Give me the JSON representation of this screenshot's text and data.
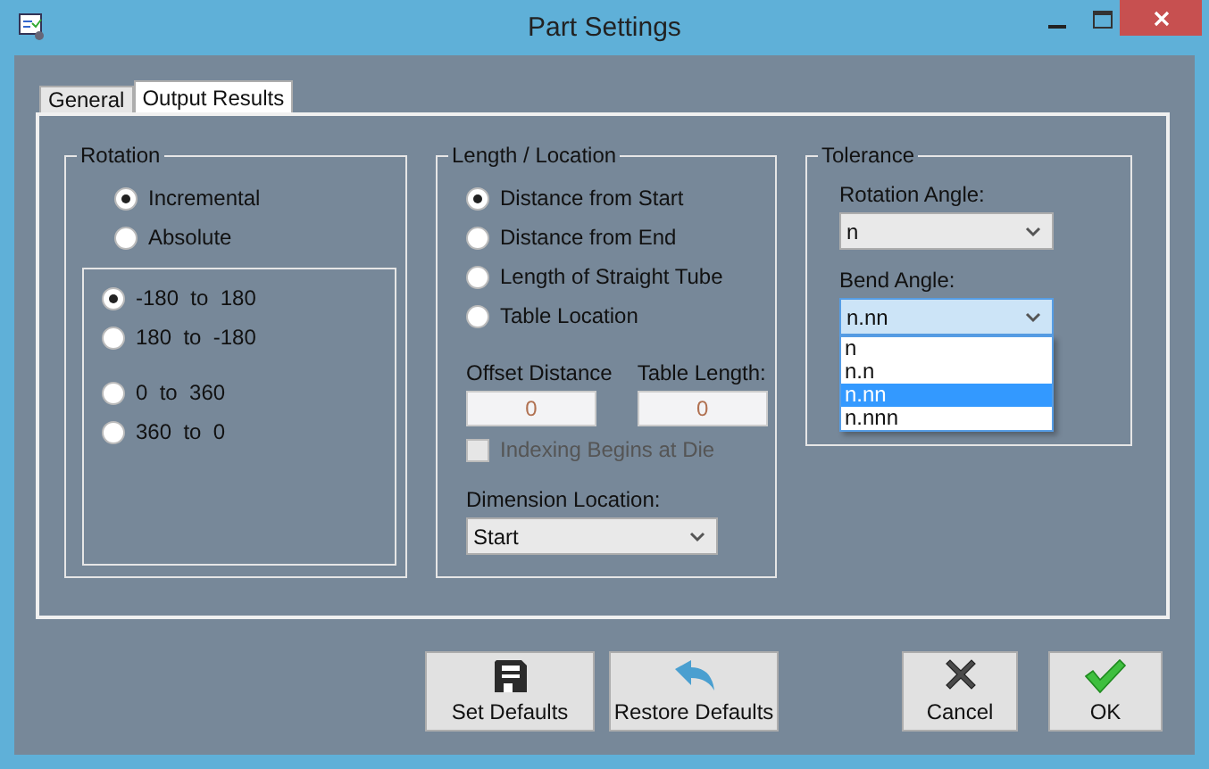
{
  "window": {
    "title": "Part Settings"
  },
  "tabs": [
    {
      "label": "General",
      "selected": false
    },
    {
      "label": "Output Results",
      "selected": true
    }
  ],
  "rotation": {
    "title": "Rotation",
    "mode_options": [
      {
        "label": "Incremental",
        "selected": true
      },
      {
        "label": "Absolute",
        "selected": false
      }
    ],
    "range_groups": [
      [
        {
          "label": "-180  to  180",
          "selected": true
        },
        {
          "label": "180  to  -180",
          "selected": false
        }
      ],
      [
        {
          "label": "0  to  360",
          "selected": false
        },
        {
          "label": "360  to  0",
          "selected": false
        }
      ]
    ]
  },
  "length_location": {
    "title": "Length / Location",
    "options": [
      {
        "label": "Distance from Start",
        "selected": true
      },
      {
        "label": "Distance from End",
        "selected": false
      },
      {
        "label": "Length of Straight Tube",
        "selected": false
      },
      {
        "label": "Table Location",
        "selected": false
      }
    ],
    "offset_distance": {
      "label": "Offset Distance",
      "value": "0",
      "disabled": true
    },
    "table_length": {
      "label": "Table Length:",
      "value": "0",
      "disabled": true
    },
    "indexing": {
      "label": "Indexing Begins at Die",
      "checked": false,
      "disabled": true
    },
    "dimension_location": {
      "label": "Dimension Location:",
      "value": "Start"
    }
  },
  "tolerance": {
    "title": "Tolerance",
    "rotation_angle": {
      "label": "Rotation Angle:",
      "value": "n",
      "expanded": false
    },
    "bend_angle": {
      "label": "Bend Angle:",
      "value": "n.nn",
      "expanded": true,
      "options": [
        {
          "label": "n",
          "selected": false
        },
        {
          "label": "n.n",
          "selected": false
        },
        {
          "label": "n.nn",
          "selected": true
        },
        {
          "label": "n.nnn",
          "selected": false
        }
      ]
    }
  },
  "buttons": [
    {
      "label": "Set Defaults",
      "kind": "save"
    },
    {
      "label": "Restore Defaults",
      "kind": "restore"
    },
    {
      "label": "Cancel",
      "kind": "cancel"
    },
    {
      "label": "OK",
      "kind": "ok"
    }
  ]
}
